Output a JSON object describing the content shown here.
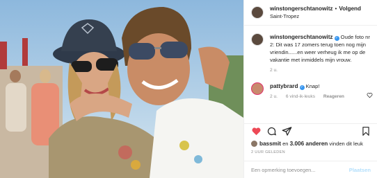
{
  "header": {
    "username": "winstongerschtanowitz",
    "separator": "•",
    "follow_label": "Volgend",
    "location": "Saint-Tropez"
  },
  "caption": {
    "username": "winstongerschtanowitz",
    "verified_icon": "verified-badge-icon",
    "text": "Oude foto nr 2: Dit was 17 zomers terug toen nog mijn vriendin......en weer verheug ik me op de vakantie met inmiddels mijn vrouw.",
    "time": "2 u."
  },
  "comments": [
    {
      "username": "pattybrard",
      "verified_icon": "verified-badge-icon",
      "text": "Knap!",
      "time": "2 u.",
      "likes": "6 vind-ik-leuks",
      "reply": "Reageren"
    }
  ],
  "actions": {
    "icons": [
      "heart-icon",
      "comment-icon",
      "share-icon",
      "bookmark-icon"
    ],
    "like_color": "#ed4956"
  },
  "likes": {
    "user": "bassmit",
    "connector": "en",
    "count": "3.006 anderen",
    "suffix": "vinden dit leuk"
  },
  "timestamp": "2 UUR GELEDEN",
  "add_comment": {
    "placeholder": "Een opmerking toevoegen...",
    "post_label": "Plaatsen"
  }
}
